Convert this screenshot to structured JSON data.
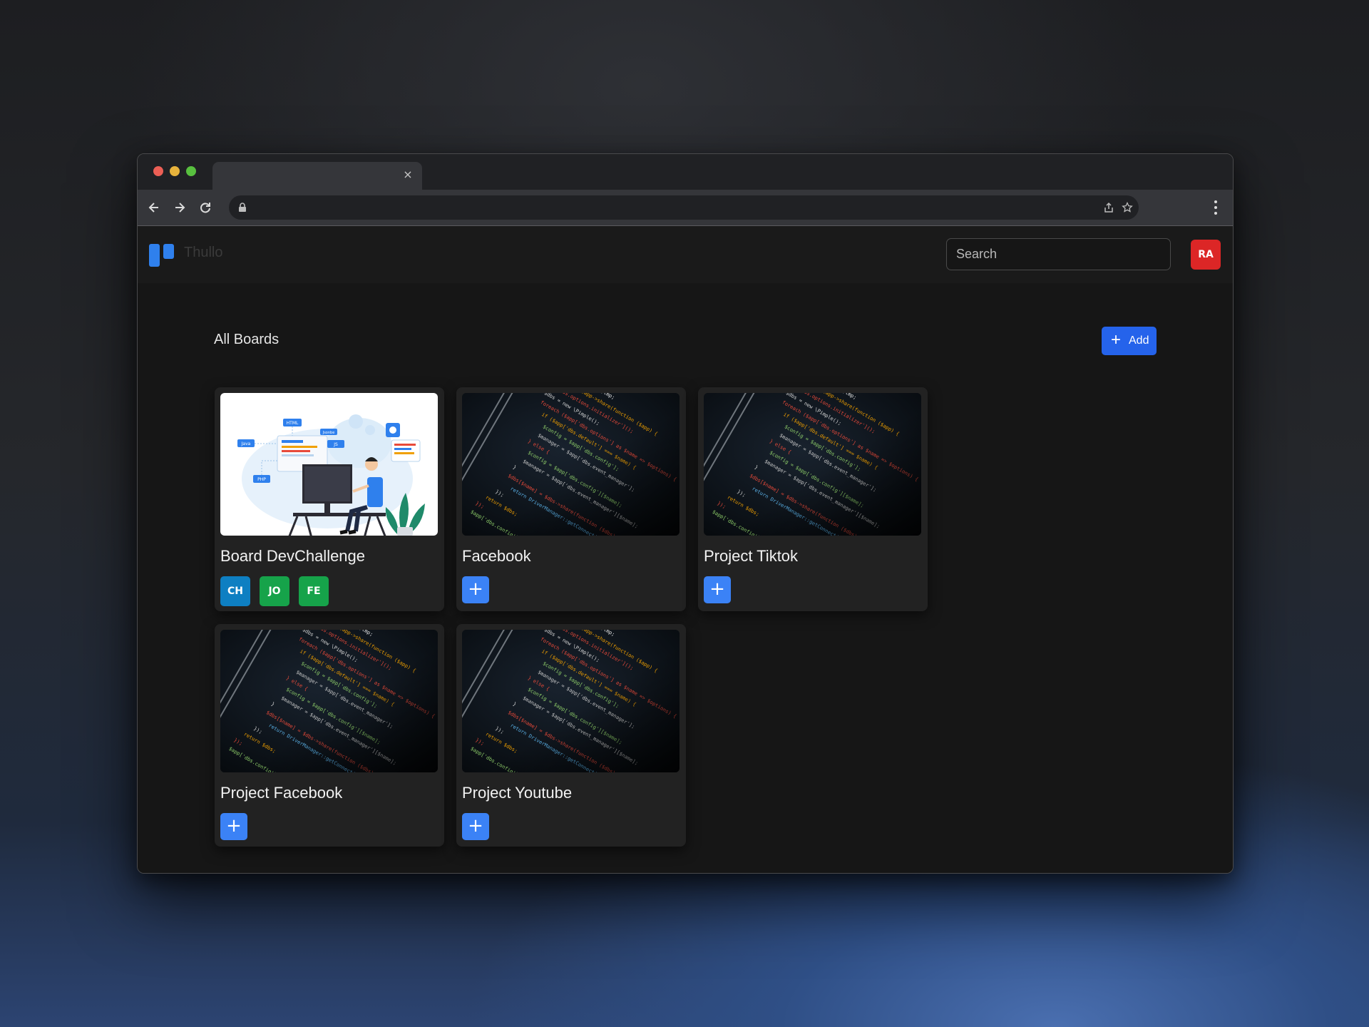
{
  "browser": {
    "tab_close_glyph": "×"
  },
  "app": {
    "brand": "Thullo",
    "search_placeholder": "Search",
    "user_initials": "RA",
    "user_color": "#dc2626"
  },
  "boards_section": {
    "title": "All Boards",
    "add_label": "Add",
    "add_icon": "+"
  },
  "boards": [
    {
      "title": "Board DevChallenge",
      "image": "developer-illustration",
      "members": [
        "CH",
        "JO",
        "FE"
      ]
    },
    {
      "title": "Facebook",
      "image": "code-screen",
      "add_icon": "+"
    },
    {
      "title": "Project Tiktok",
      "image": "code-screen",
      "add_icon": "+"
    },
    {
      "title": "Project Facebook",
      "image": "code-screen",
      "add_icon": "+"
    },
    {
      "title": "Project Youtube",
      "image": "code-screen",
      "add_icon": "+"
    }
  ],
  "illustration_labels": [
    "HTML",
    "Java",
    "Jsonbe",
    "JS",
    "PHP"
  ],
  "colors": {
    "accent": "#2563eb",
    "card_add": "#3b82f6",
    "avatar_ch": "#0e7fc2",
    "avatar_green": "#16a34a"
  }
}
